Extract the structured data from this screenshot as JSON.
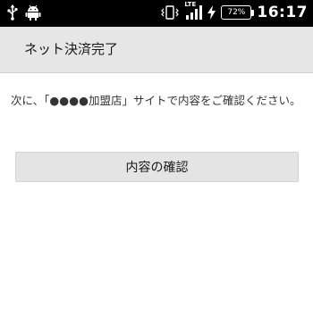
{
  "status_bar": {
    "icons_left": [
      "usb-icon",
      "android-icon"
    ],
    "icons_right": [
      "vibrate-icon",
      "signal-icon",
      "charging-icon"
    ],
    "network_label": "LTE",
    "battery_percent": "72%",
    "time": "16:17"
  },
  "app_bar": {
    "title": "ネット決済完了"
  },
  "content": {
    "message": "次に、「●●●●加盟店」サイトで内容をご確認ください。",
    "confirm_button_label": "内容の確認"
  },
  "colors": {
    "status_bar_bg": "#000000",
    "app_bar_bg": "#e6e6e6",
    "button_bg": "#e4e4e4",
    "page_bg": "#ffffff"
  }
}
